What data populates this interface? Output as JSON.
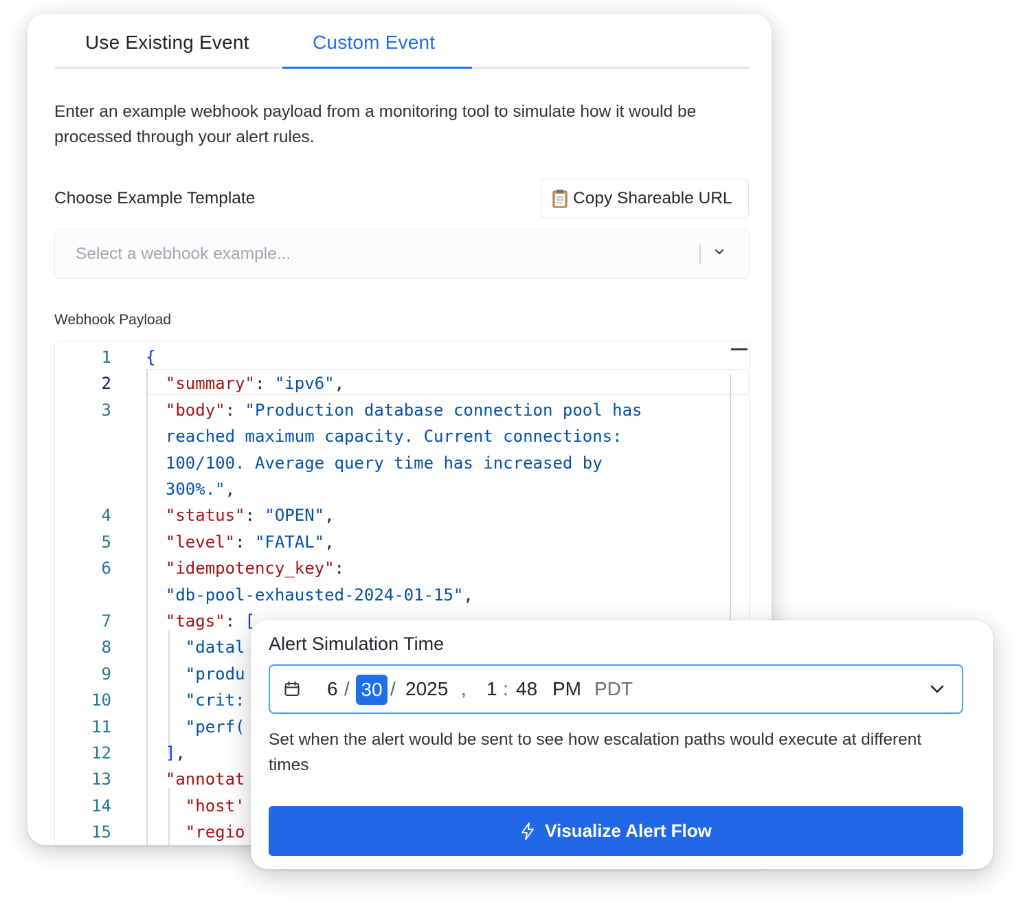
{
  "tabs": {
    "existing": "Use Existing Event",
    "custom": "Custom Event"
  },
  "description": "Enter an example webhook payload from a monitoring tool to simulate how it would be processed through your alert rules.",
  "template": {
    "label": "Choose Example Template",
    "copy_button": "Copy Shareable URL",
    "copy_icon": "clipboard-icon",
    "select_placeholder": "Select a webhook example..."
  },
  "payload": {
    "label": "Webhook Payload",
    "lines": [
      {
        "n": "1",
        "parts": [
          [
            "b",
            "{"
          ]
        ]
      },
      {
        "n": "2",
        "parts": [
          [
            "p",
            "  "
          ],
          [
            "k",
            "\"summary\""
          ],
          [
            "p",
            ": "
          ],
          [
            "s",
            "\"ipv6\""
          ],
          [
            "p",
            ","
          ]
        ]
      },
      {
        "n": "3",
        "parts": [
          [
            "p",
            "  "
          ],
          [
            "k",
            "\"body\""
          ],
          [
            "p",
            ": "
          ],
          [
            "s",
            "\"Production database connection pool has"
          ]
        ]
      },
      {
        "n": "",
        "parts": [
          [
            "s",
            "  reached maximum capacity. Current connections:"
          ]
        ]
      },
      {
        "n": "",
        "parts": [
          [
            "s",
            "  100/100. Average query time has increased by"
          ]
        ]
      },
      {
        "n": "",
        "parts": [
          [
            "s",
            "  300%.\""
          ],
          [
            "p",
            ","
          ]
        ]
      },
      {
        "n": "4",
        "parts": [
          [
            "p",
            "  "
          ],
          [
            "k",
            "\"status\""
          ],
          [
            "p",
            ": "
          ],
          [
            "s",
            "\"OPEN\""
          ],
          [
            "p",
            ","
          ]
        ]
      },
      {
        "n": "5",
        "parts": [
          [
            "p",
            "  "
          ],
          [
            "k",
            "\"level\""
          ],
          [
            "p",
            ": "
          ],
          [
            "s",
            "\"FATAL\""
          ],
          [
            "p",
            ","
          ]
        ]
      },
      {
        "n": "6",
        "parts": [
          [
            "p",
            "  "
          ],
          [
            "k",
            "\"idempotency_key\""
          ],
          [
            "p",
            ":"
          ]
        ]
      },
      {
        "n": "",
        "parts": [
          [
            "s",
            "  \"db-pool-exhausted-2024-01-15\""
          ],
          [
            "p",
            ","
          ]
        ]
      },
      {
        "n": "7",
        "parts": [
          [
            "p",
            "  "
          ],
          [
            "k",
            "\"tags\""
          ],
          [
            "p",
            ": "
          ],
          [
            "b",
            "["
          ]
        ]
      },
      {
        "n": "8",
        "parts": [
          [
            "p",
            "    "
          ],
          [
            "s",
            "\"datal"
          ]
        ]
      },
      {
        "n": "9",
        "parts": [
          [
            "p",
            "    "
          ],
          [
            "s",
            "\"produ"
          ]
        ]
      },
      {
        "n": "10",
        "parts": [
          [
            "p",
            "    "
          ],
          [
            "s",
            "\"crit:"
          ]
        ]
      },
      {
        "n": "11",
        "parts": [
          [
            "p",
            "    "
          ],
          [
            "s",
            "\"perf("
          ]
        ]
      },
      {
        "n": "12",
        "parts": [
          [
            "p",
            "  "
          ],
          [
            "b",
            "]"
          ],
          [
            "p",
            ","
          ]
        ]
      },
      {
        "n": "13",
        "parts": [
          [
            "p",
            "  "
          ],
          [
            "k",
            "\"annotat"
          ]
        ]
      },
      {
        "n": "14",
        "parts": [
          [
            "p",
            "    "
          ],
          [
            "k",
            "\"host'"
          ]
        ]
      },
      {
        "n": "15",
        "parts": [
          [
            "p",
            "    "
          ],
          [
            "k",
            "\"regio"
          ]
        ]
      }
    ]
  },
  "simulation": {
    "title": "Alert Simulation Time",
    "calendar_icon": "calendar-icon",
    "month": "6",
    "day": "30",
    "year": "2025",
    "hour": "1",
    "minute": "48",
    "ampm": "PM",
    "timezone": "PDT",
    "help": "Set when the alert would be sent to see how escalation paths would execute at different times",
    "button": "Visualize Alert Flow",
    "button_icon": "lightning-icon"
  },
  "colors": {
    "accent": "#1f6feb",
    "button": "#2068e6",
    "json_key": "#a31515",
    "json_string": "#0451a5",
    "line_number": "#237893"
  }
}
